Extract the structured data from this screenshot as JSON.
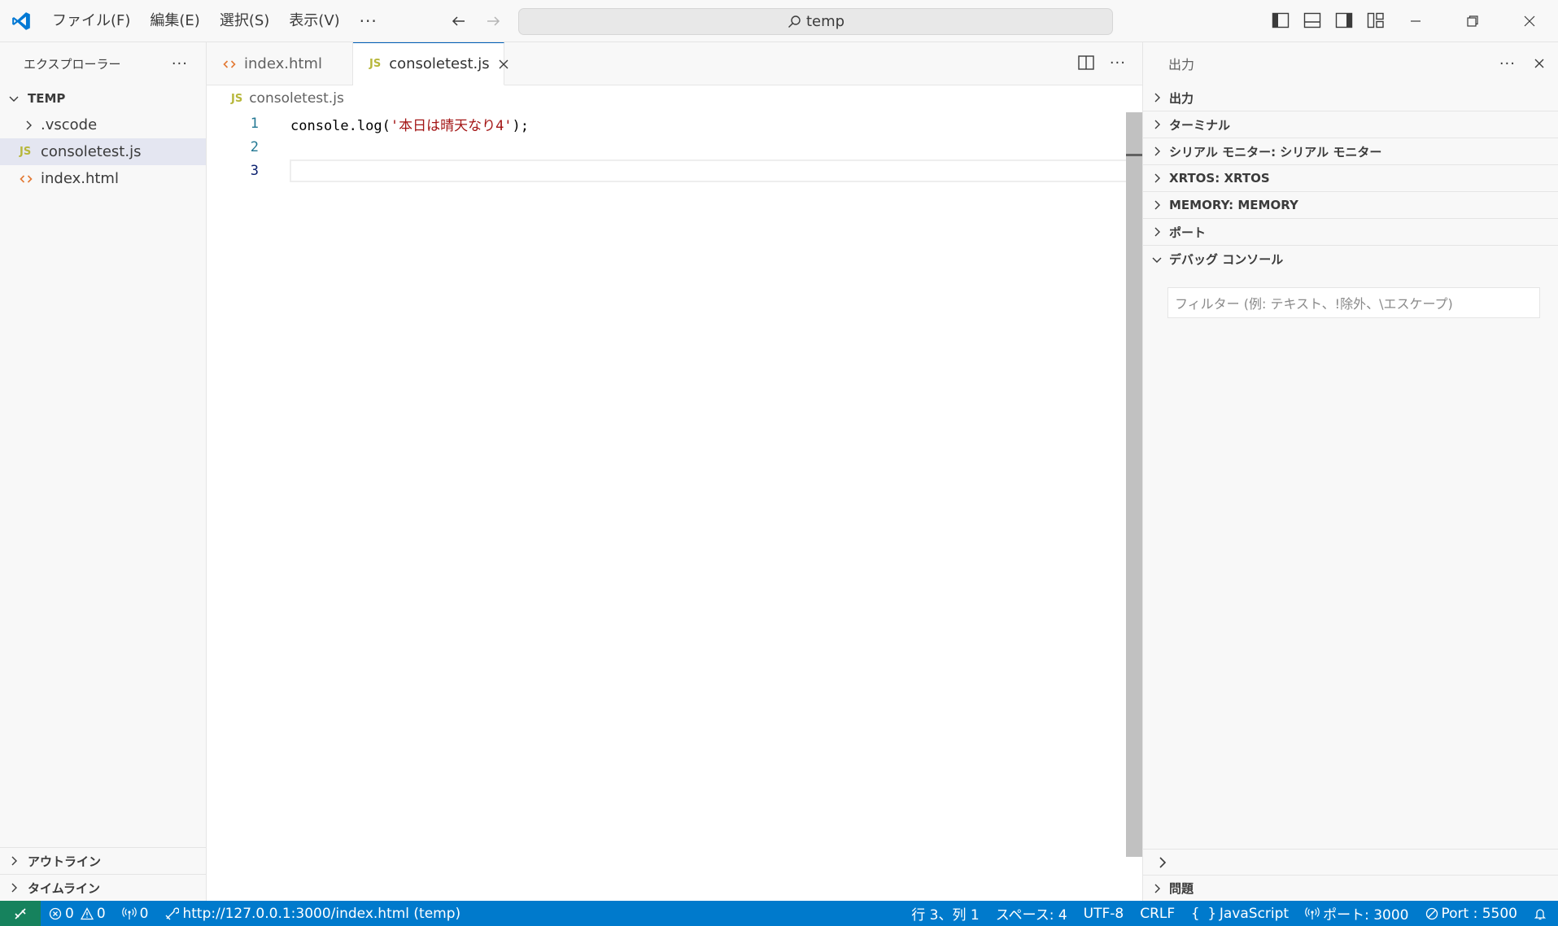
{
  "titlebar": {
    "menu": [
      "ファイル(F)",
      "編集(E)",
      "選択(S)",
      "表示(V)"
    ],
    "more": "···",
    "search": "temp"
  },
  "sidebar": {
    "title": "エクスプローラー",
    "more": "···",
    "root": "TEMP",
    "items": [
      {
        "label": ".vscode"
      },
      {
        "label": "consoletest.js",
        "badge": "JS"
      },
      {
        "label": "index.html"
      }
    ],
    "outline": "アウトライン",
    "timeline": "タイムライン"
  },
  "editor": {
    "tabs": [
      {
        "label": "index.html"
      },
      {
        "label": "consoletest.js",
        "badge": "JS"
      }
    ],
    "more": "···",
    "breadcrumb": {
      "badge": "JS",
      "file": "consoletest.js"
    },
    "lines": [
      {
        "num": "1",
        "code_pre": "console.log(",
        "code_str": "'本日は晴天なり4'",
        "code_post": ");"
      },
      {
        "num": "2"
      },
      {
        "num": "3"
      }
    ]
  },
  "panel": {
    "title": "出力",
    "more": "···",
    "sections": [
      "出力",
      "ターミナル",
      "シリアル モニター: シリアル モニター",
      "XRTOS: XRTOS",
      "MEMORY: MEMORY",
      "ポート"
    ],
    "debug_section": "デバッグ コンソール",
    "filter_placeholder": "フィルター (例: テキスト、!除外、\\エスケープ)",
    "problems": "問題"
  },
  "statusbar": {
    "errors": "0",
    "warnings": "0",
    "ports_forwarded": "0",
    "live_url": "http://127.0.0.1:3000/index.html (temp)",
    "position": "行 3、列 1",
    "spaces": "スペース: 4",
    "encoding": "UTF-8",
    "eol": "CRLF",
    "language": "JavaScript",
    "port_3000": "ポート: 3000",
    "port_5500": "Port : 5500"
  },
  "colors": {
    "accent": "#007acc",
    "remote": "#16825d",
    "string": "#a31515",
    "js_badge": "#b7b73b",
    "html_badge": "#e37933"
  }
}
